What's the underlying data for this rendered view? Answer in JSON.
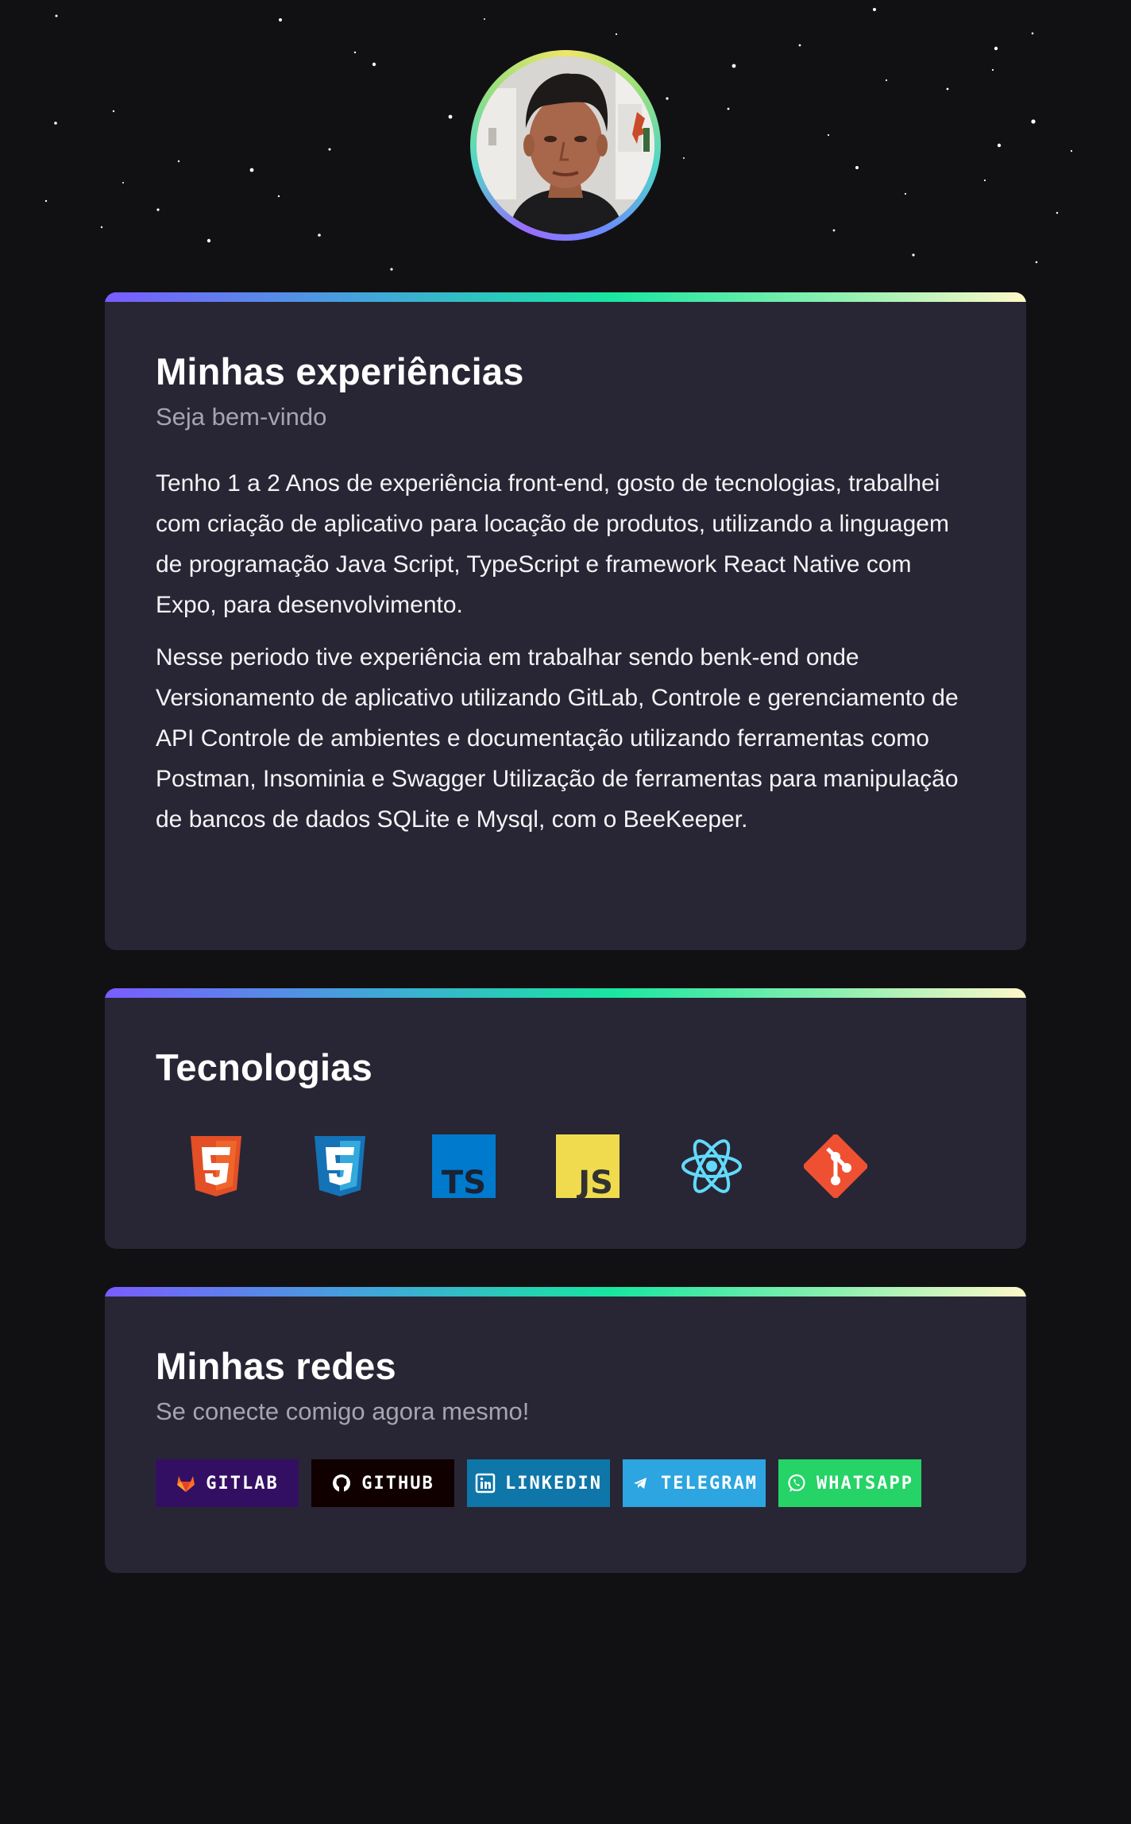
{
  "profile": {
    "photo_alt": "Profile photo"
  },
  "experience": {
    "title": "Minhas experiências",
    "subtitle": "Seja bem-vindo",
    "paragraph_1": "Tenho 1 a 2 Anos de experiência front-end, gosto de tecnologias, trabalhei com criação de aplicativo para locação de produtos, utilizando a linguagem de programação Java Script, TypeScript e framework React Native com Expo, para desenvolvimento.",
    "paragraph_2": "Nesse periodo tive experiência em trabalhar sendo benk-end onde Versionamento de aplicativo utilizando GitLab, Controle e gerenciamento de API Controle de ambientes e documentação utilizando ferramentas como Postman, Insominia e Swagger Utilização de ferramentas para manipulação de bancos de dados SQLite e Mysql, com o BeeKeeper."
  },
  "technologies": {
    "title": "Tecnologias",
    "items": [
      {
        "icon": "html5-icon",
        "color": "#E34F26"
      },
      {
        "icon": "css3-icon",
        "color": "#1572B6"
      },
      {
        "icon": "typescript-icon",
        "color": "#007ACC",
        "text": "TS"
      },
      {
        "icon": "javascript-icon",
        "color": "#F0DB4F",
        "text": "JS"
      },
      {
        "icon": "react-icon",
        "color": "#61DAFB"
      },
      {
        "icon": "git-icon",
        "color": "#F05032"
      }
    ]
  },
  "networks": {
    "title": "Minhas redes",
    "subtitle": "Se conecte comigo agora mesmo!",
    "badges": [
      {
        "label": "GITLAB",
        "icon": "gitlab-icon",
        "bg": "#330F63"
      },
      {
        "label": "GITHUB",
        "icon": "github-icon",
        "bg": "#100000"
      },
      {
        "label": "LINKEDIN",
        "icon": "linkedin-icon",
        "bg": "#0E76A8"
      },
      {
        "label": "TELEGRAM",
        "icon": "telegram-icon",
        "bg": "#2CA5E0"
      },
      {
        "label": "WHATSAPP",
        "icon": "whatsapp-icon",
        "bg": "#25D366"
      }
    ]
  }
}
